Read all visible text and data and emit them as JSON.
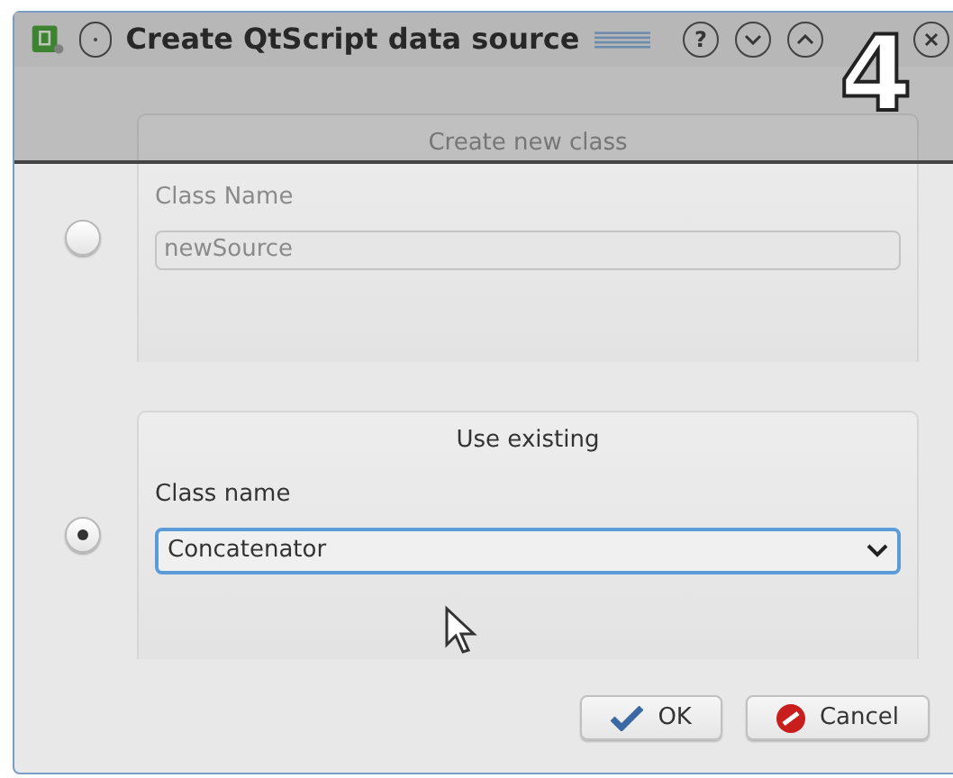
{
  "window": {
    "title": "Create QtScript data source"
  },
  "help_button": "?",
  "step_badge": "4",
  "options": [
    {
      "kind": "text",
      "selected": false,
      "disabled": true,
      "group_title": "Create new class",
      "label": "Class Name",
      "value": "newSource"
    },
    {
      "kind": "combo",
      "selected": true,
      "disabled": false,
      "group_title": "Use existing",
      "label": "Class name",
      "value": "Concatenator"
    }
  ],
  "buttons": [
    {
      "kind": "ok",
      "label": "OK"
    },
    {
      "kind": "cancel",
      "label": "Cancel"
    }
  ]
}
